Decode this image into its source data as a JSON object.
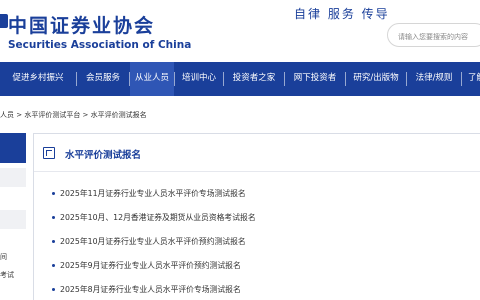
{
  "header": {
    "logo_cn": "中国证券业协会",
    "logo_en": "Securities Association of China",
    "slogan": "自律  服务  传导",
    "search_placeholder": "请输入您要搜索的内容"
  },
  "nav": {
    "items": [
      {
        "label": "促进乡村振兴"
      },
      {
        "label": "会员服务"
      },
      {
        "label": "从业人员"
      },
      {
        "label": "培训中心"
      },
      {
        "label": "投资者之家"
      },
      {
        "label": "网下投资者"
      },
      {
        "label": "研究/出版物"
      },
      {
        "label": "法律/规则"
      },
      {
        "label": "了解"
      }
    ],
    "active_index": 2
  },
  "breadcrumb": "人员 > 水平评价测试平台 > 水平评价测试报名",
  "sidebar": {
    "fragment_1": "间",
    "fragment_2": "考试"
  },
  "panel": {
    "title": "水平评价测试报名",
    "items": [
      "2025年11月证券行业专业人员水平评价专场测试报名",
      "2025年10月、12月香港证券及期货从业员资格考试报名",
      "2025年10月证券行业专业人员水平评价预约测试报名",
      "2025年9月证券行业专业人员水平评价预约测试报名",
      "2025年8月证券行业专业人员水平评价专场测试报名"
    ]
  },
  "colors": {
    "brand": "#1a3f9a",
    "nav_active": "#2f56b5",
    "sidebar_cell": "#f0f1f4"
  }
}
